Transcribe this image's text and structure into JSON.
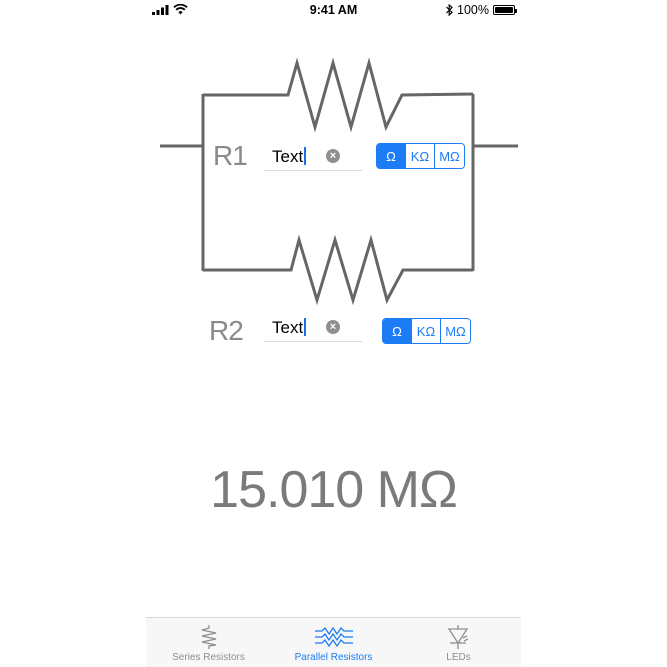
{
  "status_bar": {
    "time": "9:41 AM",
    "battery_text": "100%",
    "battery_level": 1.0
  },
  "resistors": [
    {
      "label": "R1",
      "input_value": "Text",
      "units": [
        "Ω",
        "KΩ",
        "MΩ"
      ],
      "selected_unit": "Ω"
    },
    {
      "label": "R2",
      "input_value": "Text",
      "units": [
        "Ω",
        "KΩ",
        "MΩ"
      ],
      "selected_unit": "Ω"
    }
  ],
  "result": "15.010 MΩ",
  "tab_bar": {
    "tabs": [
      {
        "label": "Series Resistors",
        "icon": "series-resistor-icon",
        "active": false
      },
      {
        "label": "Parallel Resistors",
        "icon": "parallel-resistor-icon",
        "active": true
      },
      {
        "label": "LEDs",
        "icon": "led-icon",
        "active": false
      }
    ]
  },
  "colors": {
    "accent": "#1b7cf5",
    "wire": "#666666",
    "label_gray": "#8a8a8a"
  }
}
